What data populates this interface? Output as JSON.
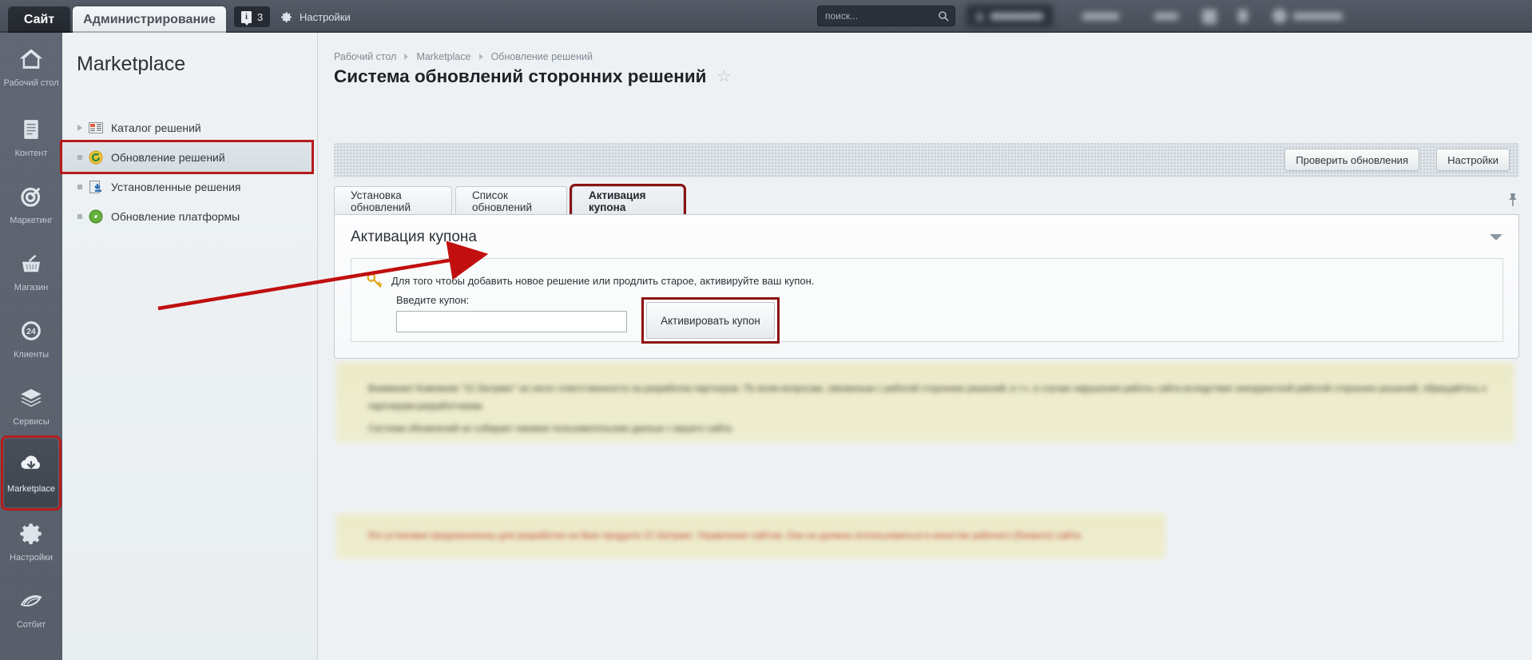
{
  "topbar": {
    "site_tab": "Сайт",
    "admin_tab": "Администрирование",
    "notif_icon": "info-icon",
    "notif_count": "3",
    "settings_label": "Настройки",
    "settings_icon": "gear-icon",
    "search_placeholder": "поиск...",
    "search_value": "",
    "search_icon": "search-icon"
  },
  "rail": {
    "items": [
      {
        "label": "Рабочий стол",
        "icon": "home-icon",
        "active": false
      },
      {
        "label": "Контент",
        "icon": "document-icon",
        "active": false
      },
      {
        "label": "Маркетинг",
        "icon": "target-icon",
        "active": false
      },
      {
        "label": "Магазин",
        "icon": "basket-icon",
        "active": false
      },
      {
        "label": "Клиенты",
        "icon": "clock24-icon",
        "active": false
      },
      {
        "label": "Сервисы",
        "icon": "layers-icon",
        "active": false
      },
      {
        "label": "Marketplace",
        "icon": "cloud-download-icon",
        "active": true
      },
      {
        "label": "Настройки",
        "icon": "gear-icon",
        "active": false
      },
      {
        "label": "Сотбит",
        "icon": "sotbit-icon",
        "active": false
      }
    ]
  },
  "marketplace_panel": {
    "title": "Marketplace",
    "items": [
      {
        "label": "Каталог решений",
        "marker": "triangle",
        "icon": "catalog-icon",
        "selected": false
      },
      {
        "label": "Обновление решений",
        "marker": "dot",
        "icon": "update-icon",
        "selected": true
      },
      {
        "label": "Установленные решения",
        "marker": "dot",
        "icon": "installed-icon",
        "selected": false
      },
      {
        "label": "Обновление платформы",
        "marker": "dot",
        "icon": "platform-update-icon",
        "selected": false
      }
    ]
  },
  "main": {
    "breadcrumb": [
      "Рабочий стол",
      "Marketplace",
      "Обновление решений"
    ],
    "page_title": "Система обновлений сторонних решений",
    "favorite_icon": "star-icon",
    "toolbar": {
      "check_updates": "Проверить обновления",
      "settings": "Настройки"
    },
    "tabs": [
      {
        "label": "Установка обновлений",
        "active": false
      },
      {
        "label": "Список обновлений",
        "active": false
      },
      {
        "label": "Активация купона",
        "active": true
      }
    ],
    "pin_icon": "pin-icon",
    "section": {
      "title": "Активация купона",
      "collapse_icon": "chevron-down-icon",
      "key_icon": "key-icon",
      "hint": "Для того чтобы добавить новое решение или продлить старое, активируйте ваш купон.",
      "coupon_label": "Введите купон:",
      "coupon_value": "",
      "coupon_placeholder": "",
      "activate_button": "Активировать купон"
    },
    "notices": {
      "notice_1_line_1": "Внимание! Компания \"1С-Битрикс\" не несет ответственности за разработки партнеров. По всем вопросам, связанным с работой сторонних решений, в т.ч. в случае нарушения работы сайта вследствие некорректной работой сторонних решений, обращайтесь к партнерам-разработчикам.",
      "notice_1_line_2": "Система обновлений не собирает никакие пользовательские данные с вашего сайта.",
      "notice_2_line_1": "Эти установки предназначены для разработки на базе продукта 1С-Битрикс: Управление сайтом. Они не должны использоваться в качестве рабочего (боевого) сайта."
    }
  },
  "annotations": {
    "arrow_color": "#c10f0f",
    "highlight_color": "#8b1111"
  }
}
